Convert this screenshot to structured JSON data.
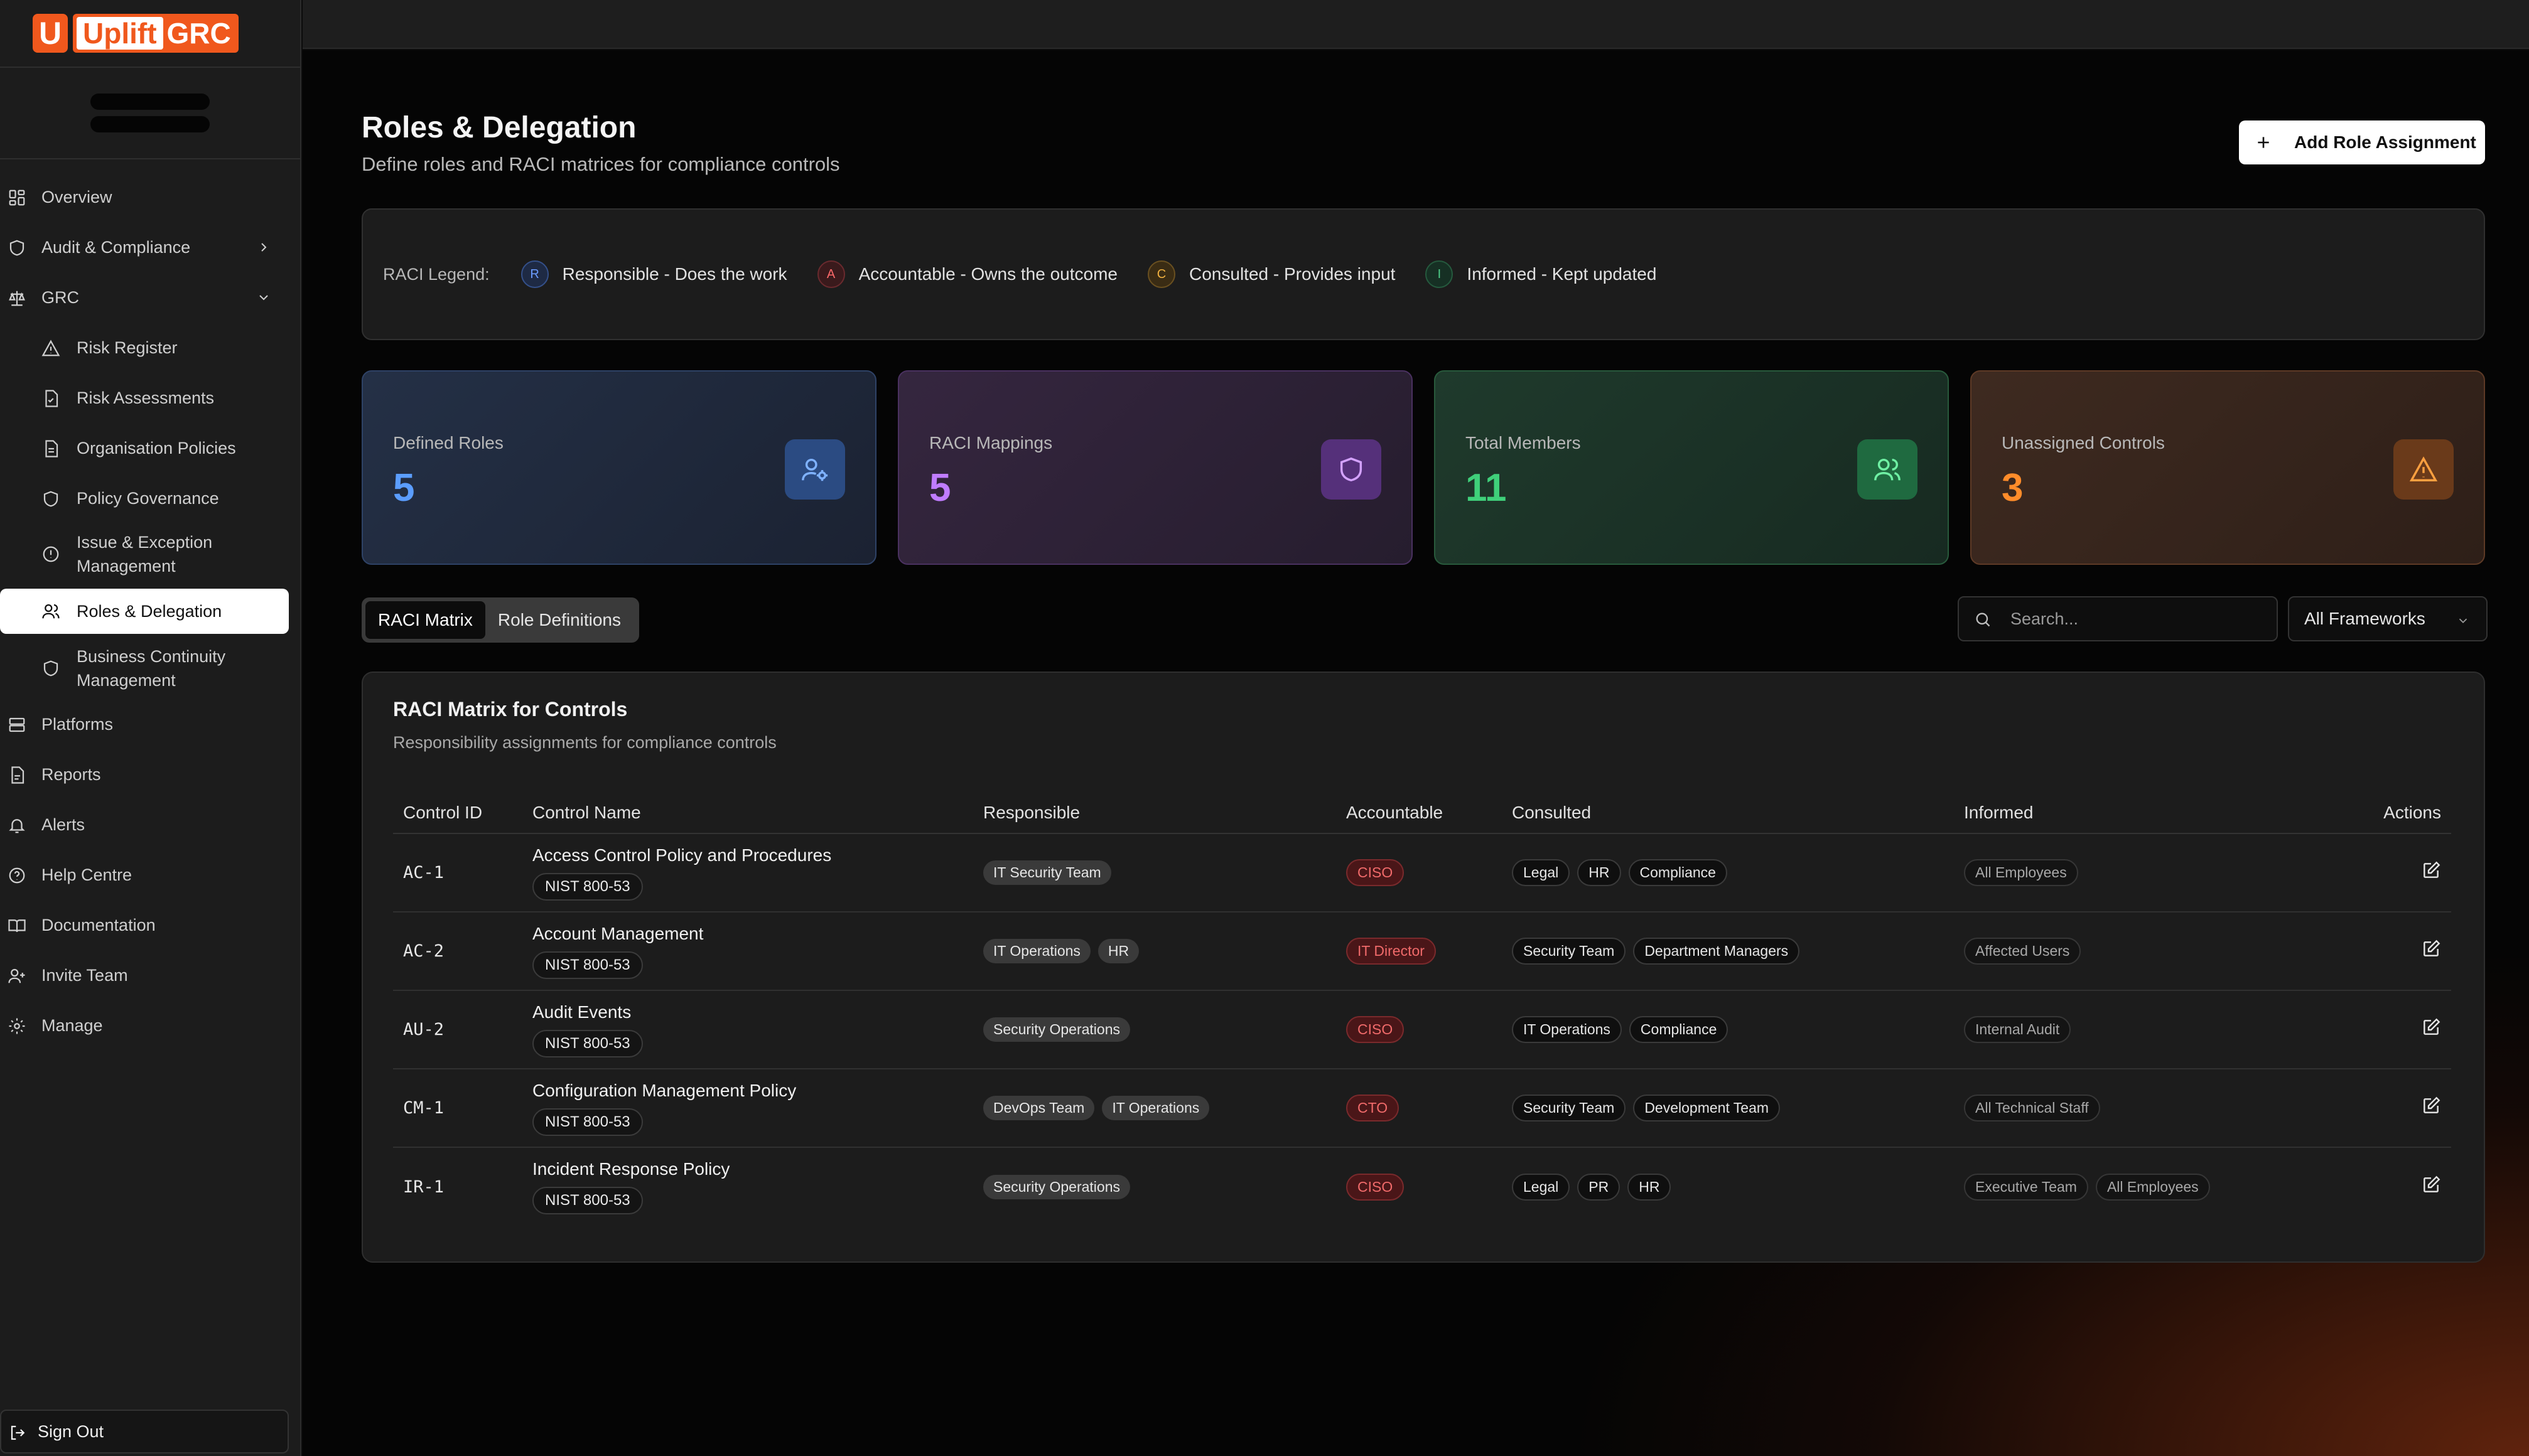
{
  "brand": {
    "mark": "U",
    "name_part1": "Uplift",
    "name_part2": "GRC"
  },
  "sidebar": {
    "items": [
      {
        "label": "Overview"
      },
      {
        "label": "Audit & Compliance"
      },
      {
        "label": "GRC"
      },
      {
        "label": "Risk Register"
      },
      {
        "label": "Risk Assessments"
      },
      {
        "label": "Organisation Policies"
      },
      {
        "label": "Policy Governance"
      },
      {
        "label": "Issue & Exception Management"
      },
      {
        "label": "Roles & Delegation"
      },
      {
        "label": "Business Continuity Management"
      },
      {
        "label": "Platforms"
      },
      {
        "label": "Reports"
      },
      {
        "label": "Alerts"
      },
      {
        "label": "Help Centre"
      },
      {
        "label": "Documentation"
      },
      {
        "label": "Invite Team"
      },
      {
        "label": "Manage"
      }
    ],
    "signout": "Sign Out"
  },
  "header": {
    "title": "Roles & Delegation",
    "subtitle": "Define roles and RACI matrices for compliance controls",
    "add_button": "Add Role Assignment"
  },
  "legend": {
    "title": "RACI Legend:",
    "items": [
      {
        "letter": "R",
        "label": "Responsible - Does the work",
        "color": "#5b8def"
      },
      {
        "letter": "A",
        "label": "Accountable - Owns the outcome",
        "color": "#e25555"
      },
      {
        "letter": "C",
        "label": "Consulted - Provides input",
        "color": "#e0a030"
      },
      {
        "letter": "I",
        "label": "Informed - Kept updated",
        "color": "#3fb07a"
      }
    ]
  },
  "stats": [
    {
      "label": "Defined Roles",
      "value": "5",
      "color": "#5b9dff",
      "icon": "user-cog-icon"
    },
    {
      "label": "RACI Mappings",
      "value": "5",
      "color": "#c07cff",
      "icon": "shield-icon"
    },
    {
      "label": "Total Members",
      "value": "11",
      "color": "#3fd07a",
      "icon": "users-icon"
    },
    {
      "label": "Unassigned Controls",
      "value": "3",
      "color": "#ff8c2a",
      "icon": "warning-icon"
    }
  ],
  "tabs": [
    {
      "label": "RACI Matrix"
    },
    {
      "label": "Role Definitions"
    }
  ],
  "search": {
    "placeholder": "Search..."
  },
  "filter": {
    "selected": "All Frameworks"
  },
  "matrix": {
    "title": "RACI Matrix for Controls",
    "subtitle": "Responsibility assignments for compliance controls",
    "columns": [
      "Control ID",
      "Control Name",
      "Responsible",
      "Accountable",
      "Consulted",
      "Informed",
      "Actions"
    ],
    "rows": [
      {
        "id": "AC-1",
        "name": "Access Control Policy and Procedures",
        "framework": "NIST 800-53",
        "responsible": [
          "IT Security Team"
        ],
        "accountable": [
          "CISO"
        ],
        "consulted": [
          "Legal",
          "HR",
          "Compliance"
        ],
        "informed": [
          "All Employees"
        ]
      },
      {
        "id": "AC-2",
        "name": "Account Management",
        "framework": "NIST 800-53",
        "responsible": [
          "IT Operations",
          "HR"
        ],
        "accountable": [
          "IT Director"
        ],
        "consulted": [
          "Security Team",
          "Department Managers"
        ],
        "informed": [
          "Affected Users"
        ]
      },
      {
        "id": "AU-2",
        "name": "Audit Events",
        "framework": "NIST 800-53",
        "responsible": [
          "Security Operations"
        ],
        "accountable": [
          "CISO"
        ],
        "consulted": [
          "IT Operations",
          "Compliance"
        ],
        "informed": [
          "Internal Audit"
        ]
      },
      {
        "id": "CM-1",
        "name": "Configuration Management Policy",
        "framework": "NIST 800-53",
        "responsible": [
          "DevOps Team",
          "IT Operations"
        ],
        "accountable": [
          "CTO"
        ],
        "consulted": [
          "Security Team",
          "Development Team"
        ],
        "informed": [
          "All Technical Staff"
        ]
      },
      {
        "id": "IR-1",
        "name": "Incident Response Policy",
        "framework": "NIST 800-53",
        "responsible": [
          "Security Operations"
        ],
        "accountable": [
          "CISO"
        ],
        "consulted": [
          "Legal",
          "PR",
          "HR"
        ],
        "informed": [
          "Executive Team",
          "All Employees"
        ]
      }
    ]
  }
}
